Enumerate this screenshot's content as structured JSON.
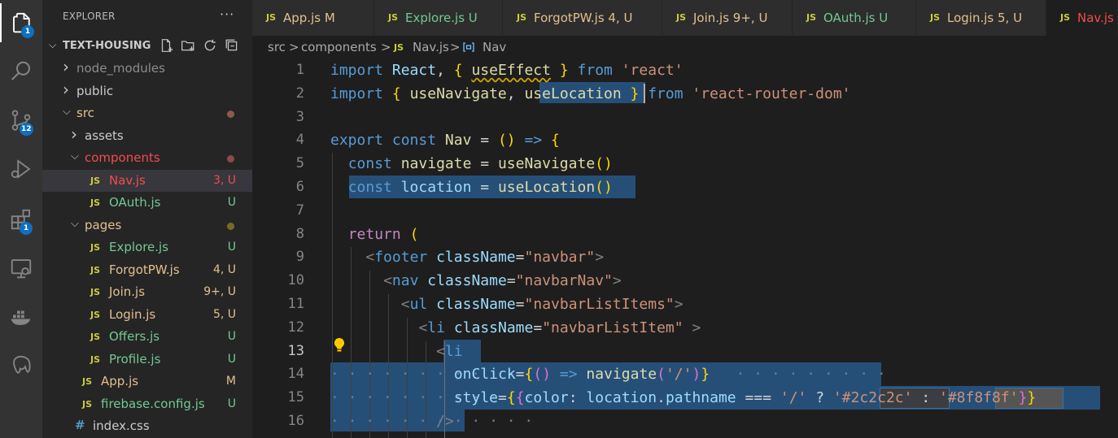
{
  "activity_bar": {
    "items": [
      {
        "icon": "files-icon",
        "badge": "1"
      },
      {
        "icon": "search-icon",
        "badge": ""
      },
      {
        "icon": "source-control-icon",
        "badge": "12"
      },
      {
        "icon": "run-debug-icon",
        "badge": ""
      },
      {
        "icon": "extensions-icon",
        "badge": "1"
      },
      {
        "icon": "remote-explorer-icon",
        "badge": ""
      },
      {
        "icon": "docker-icon",
        "badge": ""
      },
      {
        "icon": "postgres-icon",
        "badge": ""
      }
    ]
  },
  "explorer": {
    "title": "EXPLORER",
    "more": "···",
    "project": "TEXT-HOUSING",
    "tree": [
      {
        "label": "node_modules",
        "type": "folder",
        "expanded": false,
        "depth": 0,
        "status": "",
        "color": "#8c8c8c"
      },
      {
        "label": "public",
        "type": "folder",
        "expanded": false,
        "depth": 0,
        "status": "",
        "color": "#cccccc"
      },
      {
        "label": "src",
        "type": "folder",
        "expanded": true,
        "depth": 0,
        "status": "dot",
        "color": "#e2c08d",
        "dot_color": "#8c5c4a"
      },
      {
        "label": "assets",
        "type": "folder",
        "expanded": false,
        "depth": 1,
        "status": "",
        "color": "#cccccc"
      },
      {
        "label": "components",
        "type": "folder",
        "expanded": true,
        "depth": 1,
        "status": "dot",
        "color": "#f14c4c",
        "dot_color": "#8c4a4a"
      },
      {
        "label": "Nav.js",
        "type": "js",
        "depth": 2,
        "status": "3, U",
        "color": "#f14c4c",
        "selected": true
      },
      {
        "label": "OAuth.js",
        "type": "js",
        "depth": 2,
        "status": "U",
        "color": "#73c991"
      },
      {
        "label": "pages",
        "type": "folder",
        "expanded": true,
        "depth": 1,
        "status": "dot",
        "color": "#e2c08d",
        "dot_color": "#7a6a2a"
      },
      {
        "label": "Explore.js",
        "type": "js",
        "depth": 2,
        "status": "U",
        "color": "#73c991"
      },
      {
        "label": "ForgotPW.js",
        "type": "js",
        "depth": 2,
        "status": "4, U",
        "color": "#e2c08d"
      },
      {
        "label": "Join.js",
        "type": "js",
        "depth": 2,
        "status": "9+, U",
        "color": "#e2c08d"
      },
      {
        "label": "Login.js",
        "type": "js",
        "depth": 2,
        "status": "5, U",
        "color": "#e2c08d"
      },
      {
        "label": "Offers.js",
        "type": "js",
        "depth": 2,
        "status": "U",
        "color": "#73c991"
      },
      {
        "label": "Profile.js",
        "type": "js",
        "depth": 2,
        "status": "U",
        "color": "#73c991"
      },
      {
        "label": "App.js",
        "type": "js",
        "depth": 1,
        "status": "M",
        "color": "#e2c08d"
      },
      {
        "label": "firebase.config.js",
        "type": "js",
        "depth": 1,
        "status": "U",
        "color": "#73c991"
      },
      {
        "label": "index.css",
        "type": "css",
        "depth": 1,
        "status": "",
        "color": "#cccccc"
      }
    ]
  },
  "tabs": [
    {
      "label": "App.js",
      "status": "M",
      "color": "#e2c08d",
      "active": false
    },
    {
      "label": "Explore.js",
      "status": "U",
      "color": "#73c991",
      "active": false
    },
    {
      "label": "ForgotPW.js",
      "status": "4, U",
      "color": "#e2c08d",
      "active": false
    },
    {
      "label": "Join.js",
      "status": "9+, U",
      "color": "#e2c08d",
      "active": false
    },
    {
      "label": "OAuth.js",
      "status": "U",
      "color": "#73c991",
      "active": false
    },
    {
      "label": "Login.js",
      "status": "5, U",
      "color": "#e2c08d",
      "active": false
    },
    {
      "label": "Nav.js",
      "status": "",
      "color": "#f14c4c",
      "active": true
    }
  ],
  "breadcrumb": {
    "parts": [
      "src",
      ">",
      "components",
      ">",
      "JS",
      "Nav.js",
      ">",
      "Nav"
    ]
  },
  "editor": {
    "js_badge": "JS",
    "current_line": 13,
    "lines": [
      {
        "n": 1,
        "text": "import React, { useEffect } from 'react'"
      },
      {
        "n": 2,
        "text": "import { useNavigate, useLocation } from 'react-router-dom'"
      },
      {
        "n": 3,
        "text": ""
      },
      {
        "n": 4,
        "text": "export const Nav = () => {"
      },
      {
        "n": 5,
        "text": "  const navigate = useNavigate()"
      },
      {
        "n": 6,
        "text": "  const location = useLocation()"
      },
      {
        "n": 7,
        "text": ""
      },
      {
        "n": 8,
        "text": "  return ("
      },
      {
        "n": 9,
        "text": "    <footer className=\"navbar\">"
      },
      {
        "n": 10,
        "text": "      <nav className=\"navbarNav\">"
      },
      {
        "n": 11,
        "text": "        <ul className=\"navbarListItems\">"
      },
      {
        "n": 12,
        "text": "          <li className=\"navbarListItem\" >"
      },
      {
        "n": 13,
        "text": "            <li"
      },
      {
        "n": 14,
        "text": "              onClick={() => navigate('/')}"
      },
      {
        "n": 15,
        "text": "              style={{color: location.pathname === '/' ? '#2c2c2c' : '#8f8f8f'}}"
      },
      {
        "n": 16,
        "text": "            />"
      }
    ]
  },
  "colors": {
    "accent": "#0e70c0",
    "selection": "#264f78",
    "keyword": "#569cd6",
    "string": "#ce9178",
    "function": "#dcdcaa",
    "variable": "#9cdcfe"
  }
}
